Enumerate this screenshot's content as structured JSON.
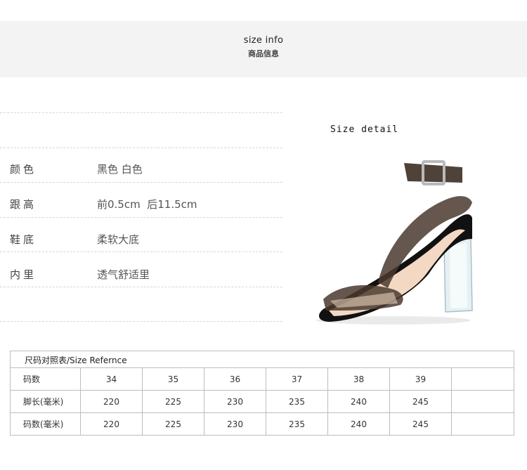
{
  "banner": {
    "title_en": "size info",
    "title_cn": "商品信息"
  },
  "attributes": [
    {
      "label": "颜色",
      "value": "黑色 白色"
    },
    {
      "label": "跟高",
      "value": "前0.5cm  后11.5cm"
    },
    {
      "label": "鞋底",
      "value": "柔软大底"
    },
    {
      "label": "内里",
      "value": "透气舒适里"
    }
  ],
  "detail": {
    "title": "Size detail"
  },
  "size_table": {
    "caption": "尺码对照表/Size Refernce",
    "rows": [
      {
        "label": "码数",
        "values": [
          "34",
          "35",
          "36",
          "37",
          "38",
          "39"
        ]
      },
      {
        "label": "脚长(毫米)",
        "values": [
          "220",
          "225",
          "230",
          "235",
          "240",
          "245"
        ]
      },
      {
        "label": "码数(毫米)",
        "values": [
          "220",
          "225",
          "230",
          "235",
          "240",
          "245"
        ]
      }
    ]
  },
  "colors": {
    "banner_bg": "#f3f3f3",
    "border": "#bdbdbd",
    "shoe_strap": "#4a3a2e"
  }
}
